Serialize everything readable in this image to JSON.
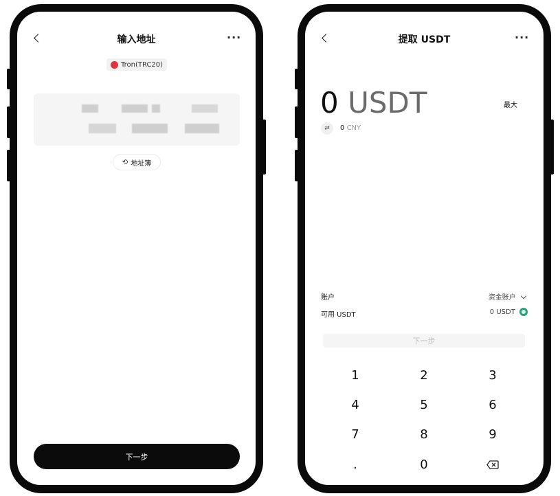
{
  "left": {
    "title": "输入地址",
    "network_chip": "Tron(TRC20)",
    "address_book_label": "地址簿",
    "next_button": "下一步"
  },
  "right": {
    "title": "提取 USDT",
    "amount_value": "0",
    "amount_unit": "USDT",
    "max_label": "最大",
    "cny_value": "0",
    "cny_unit": "CNY",
    "account_label": "账户",
    "account_value": "资金账户",
    "available_label": "可用 USDT",
    "available_value": "0 USDT",
    "next_button": "下一步",
    "keys": [
      "1",
      "2",
      "3",
      "4",
      "5",
      "6",
      "7",
      "8",
      "9",
      ".",
      "0"
    ]
  },
  "colors": {
    "primary_button": "#0b0b0b",
    "tron_red": "#e0323f",
    "usdt_green": "#26a17b"
  },
  "icons": [
    "back-chevron",
    "more-dots",
    "tron-logo",
    "refresh-arrows",
    "swap-arrows",
    "chevron-down",
    "usdt-logo",
    "backspace"
  ]
}
